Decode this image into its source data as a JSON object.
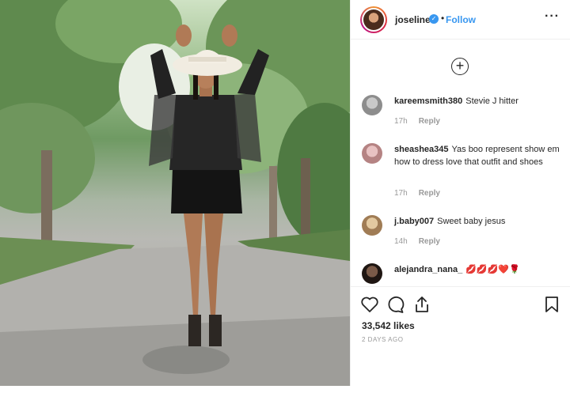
{
  "post": {
    "author": "joseline",
    "verified_symbol": "✓",
    "separator": "•",
    "follow_label": "Follow",
    "more_symbol": "···",
    "load_more_symbol": "+"
  },
  "comments": [
    {
      "user": "kareemsmith380",
      "text": "Stevie J hitter",
      "time": "17h",
      "reply": "Reply"
    },
    {
      "user": "sheashea345",
      "text": "Yas boo represent show em how to dress love that outfit and shoes",
      "time": "17h",
      "reply": "Reply"
    },
    {
      "user": "j.baby007",
      "text": "Sweet baby jesus",
      "time": "14h",
      "reply": "Reply"
    },
    {
      "user": "alejandra_nana_",
      "text": "💋💋💋❤️🌹",
      "time": "",
      "reply": ""
    }
  ],
  "engagement": {
    "likes": "33,542 likes",
    "date": "2 DAYS AGO"
  },
  "icons": [
    "heart-icon",
    "comment-icon",
    "share-icon",
    "bookmark-icon"
  ],
  "colors": {
    "accent": "#3897f0",
    "text": "#262626",
    "muted": "#999999",
    "divider": "#efefef"
  }
}
